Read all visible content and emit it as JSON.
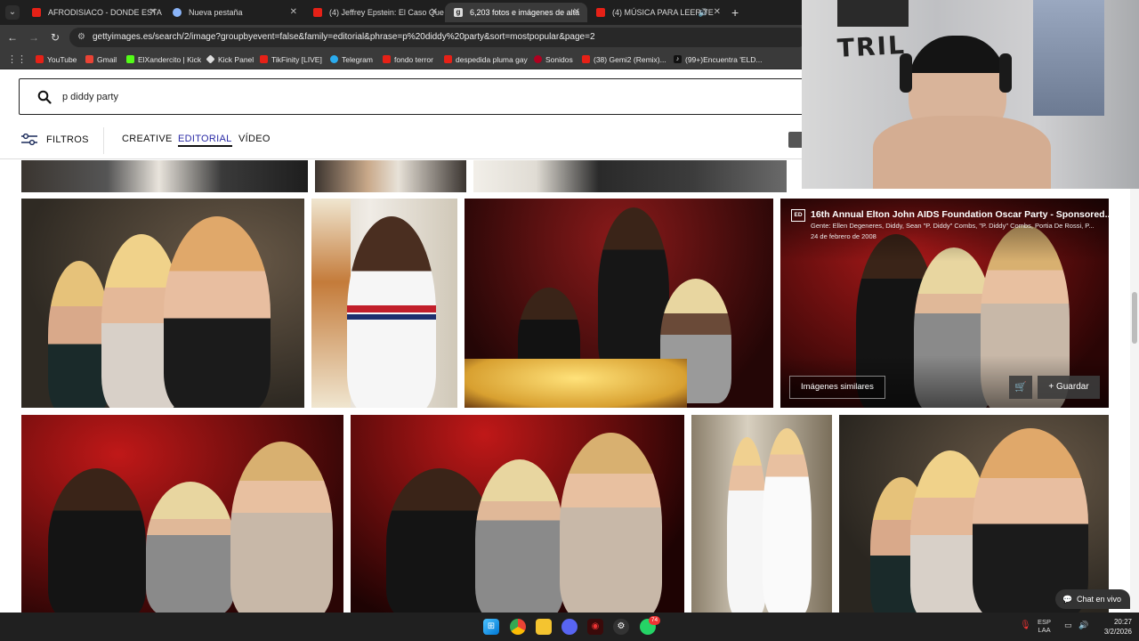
{
  "browser": {
    "tabs": [
      {
        "title": "AFRODISIACO - DONDE ESTA E",
        "favicon_color": "#e62117",
        "active": false
      },
      {
        "title": "Nueva pestaña",
        "favicon_color": "#8ab4f8",
        "active": false
      },
      {
        "title": "(4) Jeffrey Epstein: El Caso Que",
        "favicon_color": "#e62117",
        "active": false
      },
      {
        "title": "6,203 fotos e imágenes de alta",
        "favicon_color": "#dddddd",
        "active": true
      },
      {
        "title": "(4) MÚSICA PARA LEER TE",
        "favicon_color": "#e62117",
        "active": false
      }
    ],
    "new_tab": "+",
    "url": "gettyimages.es/search/2/image?groupbyevent=false&family=editorial&phrase=p%20diddy%20party&sort=mostpopular&page=2",
    "bookmarks": [
      {
        "label": "YouTube",
        "color": "#e62117"
      },
      {
        "label": "Gmail",
        "color": "#ea4335"
      },
      {
        "label": "ElXandercito | Kick",
        "color": "#53fc18"
      },
      {
        "label": "Kick Panel",
        "color": "#dddddd"
      },
      {
        "label": "TikFinity [LIVE]",
        "color": "#e62117"
      },
      {
        "label": "Telegram",
        "color": "#2aabee"
      },
      {
        "label": "fondo terror",
        "color": "#e62117"
      },
      {
        "label": "despedida pluma gay",
        "color": "#e62117"
      },
      {
        "label": "Sonidos",
        "color": "#b00020"
      },
      {
        "label": "(38) Gemi2 (Remix)...",
        "color": "#e62117"
      },
      {
        "label": "(99+)Encuentra 'ELD...",
        "color": "#111111"
      }
    ]
  },
  "search": {
    "value": "p diddy party"
  },
  "filterbar": {
    "filters_label": "FILTROS",
    "tabs": [
      {
        "label": "CREATIVE",
        "active": false
      },
      {
        "label": "EDITORIAL",
        "active": true
      },
      {
        "label": "VÍDEO",
        "active": false
      }
    ]
  },
  "hovered_image": {
    "badge": "ED",
    "title": "16th Annual Elton John AIDS Foundation Oscar Party - Sponsored...",
    "people": "Gente: Ellen Degeneres, Diddy, Sean \"P. Diddy\" Combs, \"P. Diddy\" Combs, Portia De Rossi, P...",
    "date": "24 de febrero de 2008",
    "similar_label": "Imágenes similares",
    "save_label": "Guardar"
  },
  "chat_label": "Chat en vivo",
  "taskbar": {
    "badge_count": "74",
    "lang_top": "ESP",
    "lang_bottom": "LAA",
    "time": "20:27",
    "date": "3/2/2026"
  },
  "webcam_text": "TRIL"
}
